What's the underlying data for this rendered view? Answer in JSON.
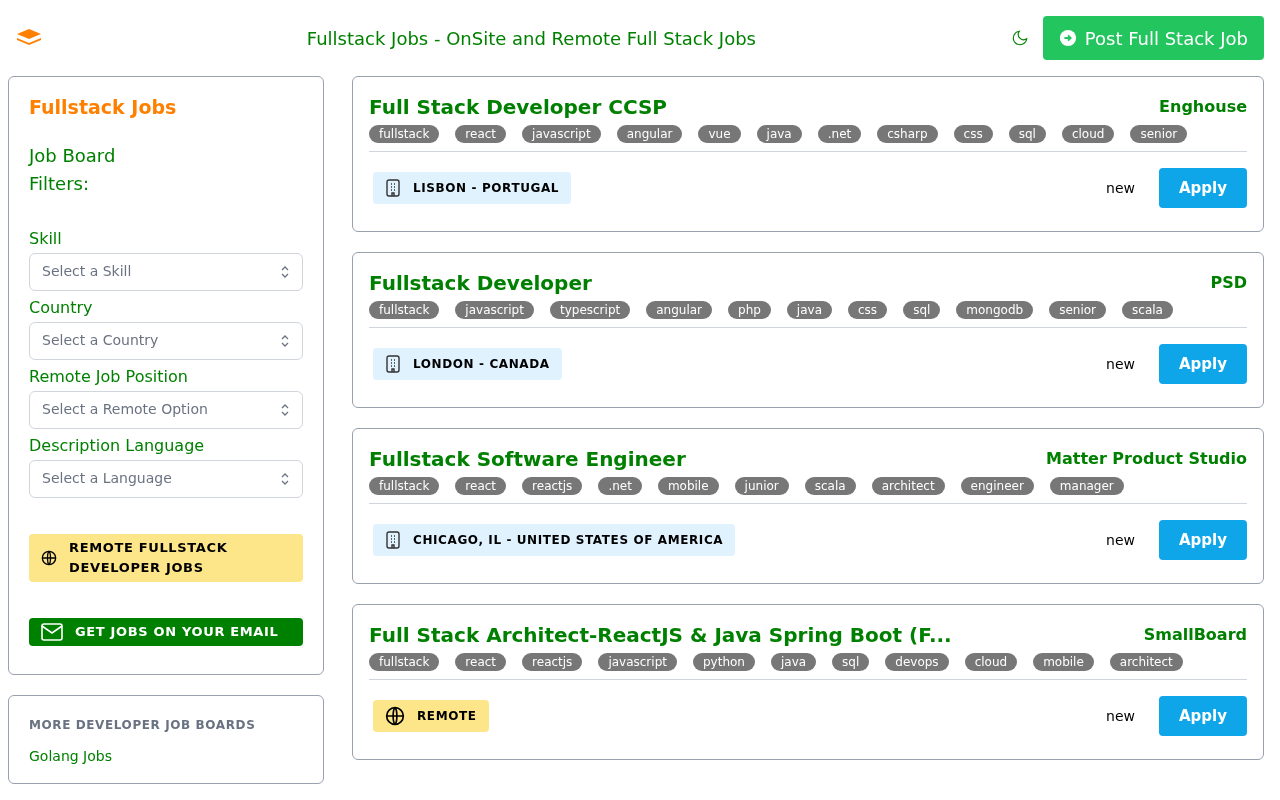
{
  "header": {
    "title": "Fullstack Jobs - OnSite and Remote Full Stack Jobs",
    "post_button": "Post Full Stack Job"
  },
  "sidebar": {
    "heading": "Fullstack Jobs",
    "subheading": "Job Board Filters:",
    "filters": [
      {
        "label": "Skill",
        "placeholder": "Select a Skill"
      },
      {
        "label": "Country",
        "placeholder": "Select a Country"
      },
      {
        "label": "Remote Job Position",
        "placeholder": "Select a Remote Option"
      },
      {
        "label": "Description Language",
        "placeholder": "Select a Language"
      }
    ],
    "remote_button": "REMOTE FULLSTACK DEVELOPER JOBS",
    "email_button": "GET JOBS ON YOUR EMAIL"
  },
  "more_boards": {
    "heading": "MORE DEVELOPER JOB BOARDS",
    "links": [
      "Golang Jobs"
    ]
  },
  "jobs": [
    {
      "title": "Full Stack Developer CCSP",
      "company": "Enghouse",
      "tags": [
        "fullstack",
        "react",
        "javascript",
        "angular",
        "vue",
        "java",
        ".net",
        "csharp",
        "css",
        "sql",
        "cloud",
        "senior"
      ],
      "location": {
        "kind": "office",
        "text": "LISBON - PORTUGAL"
      },
      "status": "new",
      "apply": "Apply"
    },
    {
      "title": "Fullstack Developer",
      "company": "PSD",
      "tags": [
        "fullstack",
        "javascript",
        "typescript",
        "angular",
        "php",
        "java",
        "css",
        "sql",
        "mongodb",
        "senior",
        "scala"
      ],
      "location": {
        "kind": "office",
        "text": "LONDON - CANADA"
      },
      "status": "new",
      "apply": "Apply"
    },
    {
      "title": "Fullstack Software Engineer",
      "company": "Matter Product Studio",
      "tags": [
        "fullstack",
        "react",
        "reactjs",
        ".net",
        "mobile",
        "junior",
        "scala",
        "architect",
        "engineer",
        "manager"
      ],
      "location": {
        "kind": "office",
        "text": "CHICAGO, IL - UNITED STATES OF AMERICA"
      },
      "status": "new",
      "apply": "Apply"
    },
    {
      "title": "Full Stack Architect-ReactJS & Java Spring Boot (F...",
      "company": "SmallBoard",
      "tags": [
        "fullstack",
        "react",
        "reactjs",
        "javascript",
        "python",
        "java",
        "sql",
        "devops",
        "cloud",
        "mobile",
        "architect"
      ],
      "location": {
        "kind": "remote",
        "text": "REMOTE"
      },
      "status": "new",
      "apply": "Apply"
    }
  ]
}
